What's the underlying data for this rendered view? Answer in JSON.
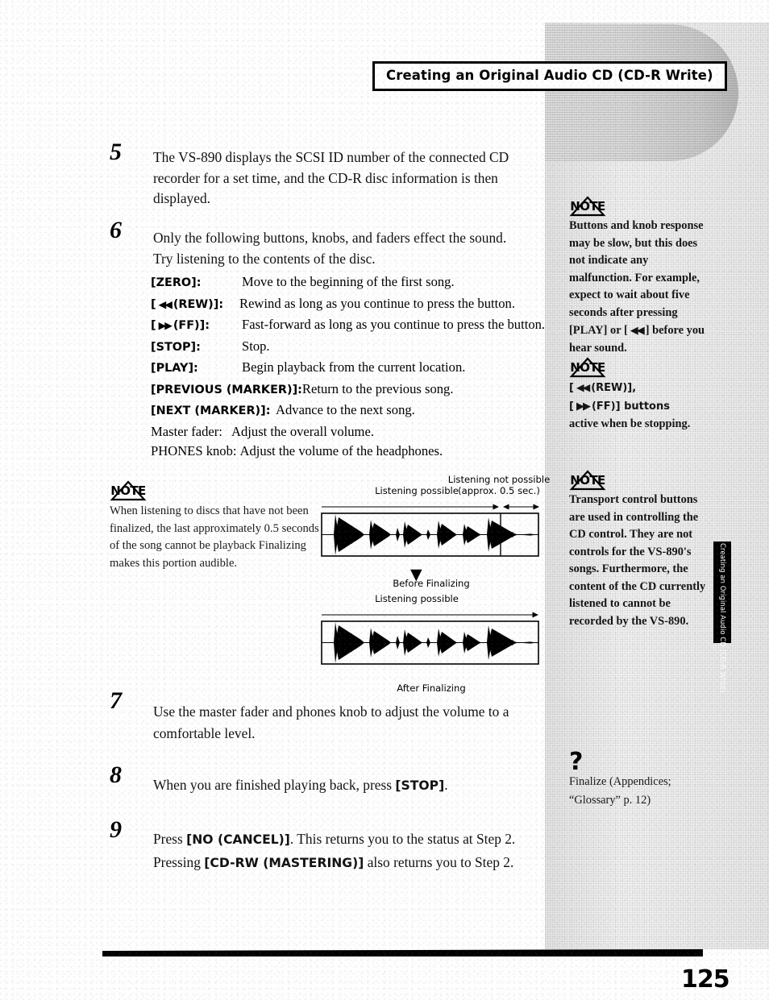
{
  "page": {
    "running_head": "Creating an Original Audio CD (CD-R Write)",
    "folio": "125",
    "thumb_tab": "Creating an Original Audio CD (CD-R Write)"
  },
  "steps": [
    {
      "number": "5",
      "text": "The VS-890 displays the SCSI ID number of the connected CD recorder for a set time, and the CD-R disc information is then displayed."
    },
    {
      "number": "6",
      "text": "Only the following buttons, knobs, and faders effect the sound. Try listening to the contents of the disc."
    },
    {
      "number": "7",
      "text": "Use the master fader and phones knob to adjust the volume to a comfortable level."
    },
    {
      "number": "8",
      "text_before": "When you are finished playing back, press ",
      "bold": "[STOP]",
      "text_after": "."
    },
    {
      "number": "9",
      "line1_a": "Press ",
      "line1_b": "[NO (CANCEL)]",
      "line1_c": ". This returns you to the status at Step 2.",
      "line2_a": "Pressing ",
      "line2_b": "[CD-RW (MASTERING)]",
      "line2_c": " also returns you to Step 2."
    }
  ],
  "button_list": [
    {
      "term": "[ZERO]:",
      "desc": "Move to the beginning of the first song.",
      "width": "w-zero"
    },
    {
      "term_pre": "[",
      "glyph": "◀◀",
      "term_post": "(REW)]:",
      "desc": "Rewind as long as you continue to press the button.",
      "width": "w-rew"
    },
    {
      "term_pre": "[",
      "glyph": "▶▶",
      "term_post": "(FF)]:",
      "desc": "Fast-forward as long as you continue to press the button.",
      "width": "w-ff"
    },
    {
      "term": "[STOP]:",
      "desc": "Stop.",
      "width": "w-stop"
    },
    {
      "term": "[PLAY]:",
      "desc": "Begin playback from the current location.",
      "width": "w-play"
    },
    {
      "term": "[PREVIOUS (MARKER)]:",
      "desc": "Return to the previous song.",
      "width": "w-prev"
    },
    {
      "term": "[NEXT (MARKER)]:",
      "desc": "Advance to the next song.",
      "width": "w-next"
    },
    {
      "term": "Master fader:",
      "desc": "Adjust the overall volume.",
      "plain": true,
      "width": "w-fader"
    },
    {
      "term": "PHONES knob:",
      "desc": "Adjust the volume of the headphones.",
      "plain": true,
      "width": "w-phones"
    }
  ],
  "note_left": {
    "icon_word": "NOTE",
    "text": "When listening to discs that have not been finalized, the last approximately 0.5 seconds of the song cannot be playback Finalizing makes this portion audible."
  },
  "sidebar_notes": [
    {
      "icon_word": "NOTE",
      "para1": "Buttons and knob response may be slow, but this does not indicate any malfunction. For example, expect to wait about five seconds after pressing",
      "line_a": "[PLAY] or [",
      "line_glyph": "◀◀",
      "line_b": "] before",
      "line_c": "you hear sound."
    },
    {
      "icon_word": "NOTE",
      "line1_pre": "[",
      "line1_glyph": "◀◀",
      "line1_post": "(REW)],",
      "line2_pre": "[",
      "line2_glyph": "▶▶",
      "line2_post": "(FF)] buttons",
      "line3": "active when be stopping."
    },
    {
      "icon_word": "NOTE",
      "para1": "Transport control buttons are used in controlling the CD control. They are not controls for the VS-890's songs. Furthermore, the content of the CD currently listened to cannot be recorded by the VS-890."
    }
  ],
  "glossary_note": {
    "icon": "?",
    "line1": "Finalize (Appendices;",
    "line2": "“Glossary” p. 12)"
  },
  "figures": [
    {
      "id": "before-finalizing",
      "caption": "Before Finalizing",
      "label_possible": "Listening possible",
      "label_not_possible_line1": "Listening not possible",
      "label_not_possible_line2": "(approx. 0.5 sec.)"
    },
    {
      "id": "after-finalizing",
      "caption": "After Finalizing",
      "label_possible": "Listening possible",
      "separator_glyph": "▼"
    }
  ]
}
